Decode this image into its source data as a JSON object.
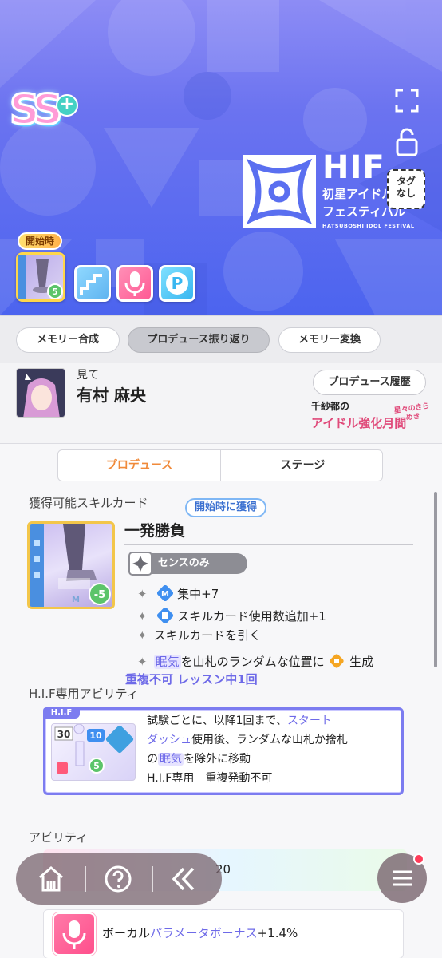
{
  "hero": {
    "rank": "SS",
    "rank_plus": "+",
    "logo_title": "HIF",
    "logo_jp_line1": "初星アイドル",
    "logo_jp_line2": "フェスティバル",
    "logo_en": "HATSUBOSHI IDOL FESTIVAL",
    "tag_none_line1": "タグ",
    "tag_none_line2": "なし",
    "start_label": "開始時",
    "card_cost": "5"
  },
  "tabs": {
    "memory_synthesis": "メモリー合成",
    "produce_review": "プロデュース振り返り",
    "memory_exchange": "メモリー変換"
  },
  "character": {
    "sub": "見て",
    "name": "有村 麻央",
    "history_button": "プロデュース履歴",
    "event_line1": "千紗都",
    "event_line1b": "の",
    "event_line2": "アイドル強化月間",
    "event_badge": "星々のきらめき"
  },
  "segments": {
    "produce": "プロデュース",
    "stage": "ステージ"
  },
  "skill": {
    "section_title": "獲得可能スキルカード",
    "start_tag": "開始時に獲得",
    "name": "一発勝負",
    "sense_only": "センスのみ",
    "card_cost": "-5",
    "effect1": "集中+7",
    "effect2": "スキルカード使用数追加+1",
    "effect3": "スキルカードを引く",
    "effect4_pre": "眠気",
    "effect4_mid": "を山札のランダムな位置に",
    "effect4_post": "生成",
    "repeat_note": "重複不可 レッスン中1回"
  },
  "hif_ability": {
    "section_title": "H.I.F専用アビリティ",
    "badge": "H.I.F",
    "thumb_value_a": "30",
    "thumb_value_b": "10",
    "thumb_value_c": "5",
    "line1_pre": "試験ごとに、以降1回まで、",
    "line1_hl": "スタート",
    "line2_hl": "ダッシュ",
    "line2_post": "使用後、ランダムな山札か捨札",
    "line3_pre": "の",
    "line3_hl": "眠気",
    "line3_post": "を除外に移動",
    "line4": "H.I.F専用　重複発動不可"
  },
  "abilities": {
    "section_title": "アビリティ",
    "row1_value": "20",
    "vocal_pre": "ボーカル",
    "vocal_hl": "パラメータボーナス",
    "vocal_post": "+1.4%"
  },
  "icons": {
    "home": "home-icon",
    "help": "help-icon",
    "back": "back-icon",
    "menu": "menu-icon"
  },
  "colors": {
    "hero_blue": "#4c64ef",
    "accent_orange": "#f08a3a",
    "accent_purple": "#6e6ae8",
    "badge_red": "#ff3c5a"
  }
}
